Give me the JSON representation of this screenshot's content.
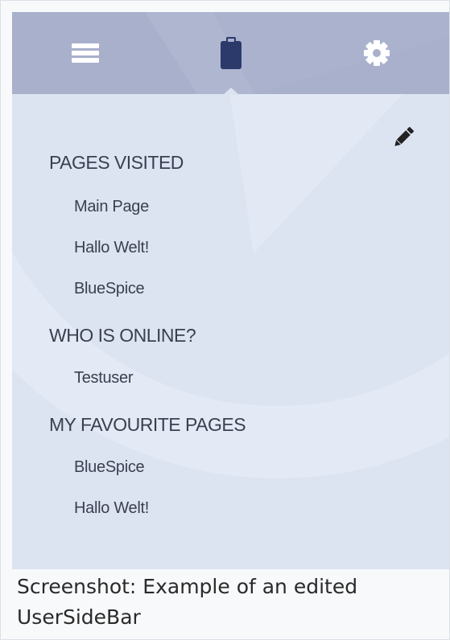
{
  "topbar": {
    "tabs": [
      {
        "icon": "hamburger-menu-icon"
      },
      {
        "icon": "clipboard-icon"
      },
      {
        "icon": "gear-icon"
      }
    ],
    "colors": {
      "bar": "#a8b0cc",
      "active_icon": "#2b3a6b",
      "icon": "#ffffff"
    }
  },
  "sidebar": {
    "edit_icon": "pencil-icon",
    "sections": [
      {
        "heading": "PAGES VISITED",
        "items": [
          "Main Page",
          "Hallo Welt!",
          "BlueSpice"
        ]
      },
      {
        "heading": "WHO IS ONLINE?",
        "items": [
          "Testuser"
        ]
      },
      {
        "heading": "MY FAVOURITE PAGES",
        "items": [
          "BlueSpice",
          "Hallo Welt!"
        ]
      }
    ]
  },
  "caption": {
    "line1": "Screenshot: Example of an edited",
    "line2": "UserSideBar"
  }
}
